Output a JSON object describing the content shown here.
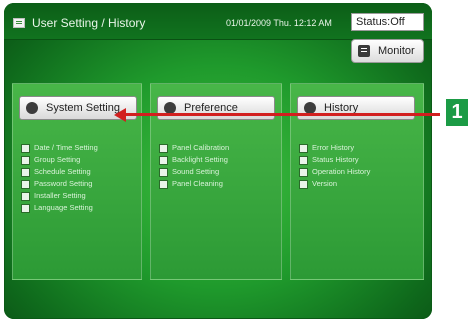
{
  "header": {
    "title": "User Setting / History",
    "datetime": "01/01/2009 Thu. 12:12 AM",
    "status_label": "Status:Off",
    "monitor_label": "Monitor"
  },
  "columns": [
    {
      "button_label": "System Setting",
      "items": [
        {
          "label": "Date / Time Setting",
          "icon": "clock-icon"
        },
        {
          "label": "Group Setting",
          "icon": "group-icon"
        },
        {
          "label": "Schedule Setting",
          "icon": "schedule-icon"
        },
        {
          "label": "Password Setting",
          "icon": "password-icon"
        },
        {
          "label": "Installer Setting",
          "icon": "installer-icon"
        },
        {
          "label": "Language Setting",
          "icon": "language-icon"
        }
      ]
    },
    {
      "button_label": "Preference",
      "items": [
        {
          "label": "Panel Calibration",
          "icon": "calibration-icon"
        },
        {
          "label": "Backlight Setting",
          "icon": "backlight-icon"
        },
        {
          "label": "Sound Setting",
          "icon": "sound-icon"
        },
        {
          "label": "Panel Cleaning",
          "icon": "cleaning-icon"
        }
      ]
    },
    {
      "button_label": "History",
      "items": [
        {
          "label": "Error History",
          "icon": "error-icon"
        },
        {
          "label": "Status History",
          "icon": "status-icon"
        },
        {
          "label": "Operation History",
          "icon": "operation-icon"
        },
        {
          "label": "Version",
          "icon": "version-icon"
        }
      ]
    }
  ],
  "callout": {
    "number": "1"
  },
  "colors": {
    "screen": "#1f9a2c",
    "callout": "#d21f1f",
    "badge": "#1b9b45"
  }
}
